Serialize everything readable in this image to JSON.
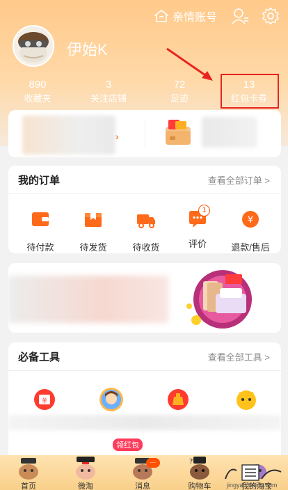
{
  "header": {
    "family_account_label": "亲情账号",
    "username": "伊始K"
  },
  "stats": [
    {
      "value": "890",
      "label": "收藏夹"
    },
    {
      "value": "3",
      "label": "关注店铺"
    },
    {
      "value": "72",
      "label": "足迹"
    },
    {
      "value": "13",
      "label": "红包卡券"
    }
  ],
  "orders": {
    "title": "我的订单",
    "view_all": "查看全部订单 >",
    "items": [
      {
        "label": "待付款",
        "icon": "wallet-icon"
      },
      {
        "label": "待发货",
        "icon": "package-icon"
      },
      {
        "label": "待收货",
        "icon": "truck-icon"
      },
      {
        "label": "评价",
        "icon": "comment-icon",
        "badge": "1"
      },
      {
        "label": "退款/售后",
        "icon": "refund-icon"
      }
    ]
  },
  "tools": {
    "title": "必备工具",
    "view_all": "查看全部工具 >",
    "tag": "领红包"
  },
  "tabbar": {
    "items": [
      {
        "label": "首页"
      },
      {
        "label": "微淘"
      },
      {
        "label": "消息",
        "badge": "···"
      },
      {
        "label": "购物车"
      },
      {
        "label": "我的淘宝"
      }
    ]
  },
  "watermark": {
    "text": "jingyan.baidu.com"
  },
  "colors": {
    "accent": "#ff5000",
    "highlight_box": "#e8231d",
    "header_gradient_top": "#ffc98a"
  }
}
